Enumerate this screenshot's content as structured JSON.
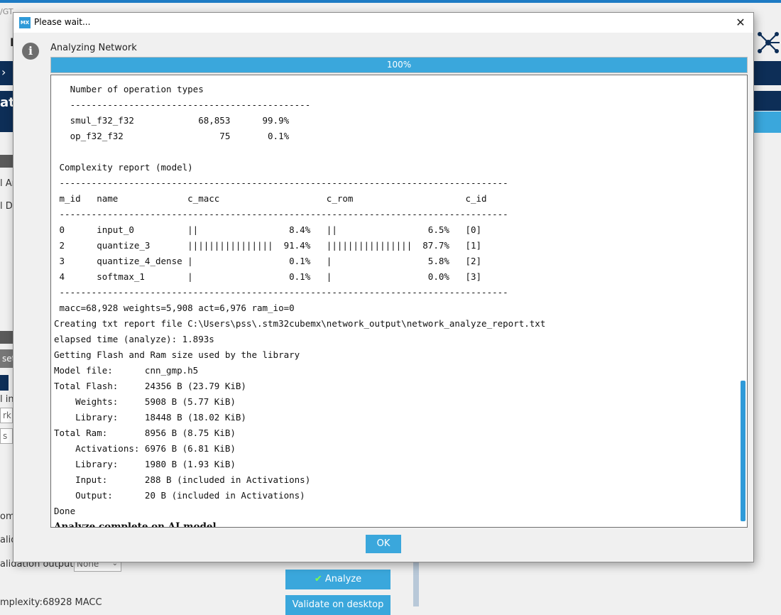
{
  "background": {
    "window_title_fragment": "/GT",
    "left_labels": [
      "ati",
      "l An",
      "l De",
      "set",
      "l in",
      "rk",
      "s",
      "omp",
      "alida"
    ],
    "validation_outputs_label": "alidation outputs:",
    "validation_outputs_value": "None",
    "complexity_label": "mplexity:",
    "complexity_value": "68928 MACC",
    "analyze_button": "Analyze",
    "validate_button": "Validate on desktop",
    "letter_d": "I"
  },
  "dialog": {
    "title": "Please wait...",
    "icon_label": "MX",
    "close_symbol": "✕",
    "status": "Analyzing Network",
    "progress_percent": 100,
    "progress_label": "100%",
    "ok_label": "OK",
    "log_lines": [
      "",
      "   Number of operation types",
      "   ---------------------------------------------",
      "   smul_f32_f32            68,853      99.9%",
      "   op_f32_f32                  75       0.1%",
      "",
      " Complexity report (model)",
      " ------------------------------------------------------------------------------------",
      " m_id   name             c_macc                    c_rom                     c_id",
      " ------------------------------------------------------------------------------------",
      " 0      input_0          ||                 8.4%   ||                 6.5%   [0]",
      " 2      quantize_3       ||||||||||||||||  91.4%   ||||||||||||||||  87.7%   [1]",
      " 3      quantize_4_dense |                  0.1%   |                  5.8%   [2]",
      " 4      softmax_1        |                  0.1%   |                  0.0%   [3]",
      " ------------------------------------------------------------------------------------",
      " macc=68,928 weights=5,908 act=6,976 ram_io=0",
      "Creating txt report file C:\\Users\\pss\\.stm32cubemx\\network_output\\network_analyze_report.txt",
      "elapsed time (analyze): 1.893s",
      "Getting Flash and Ram size used by the library",
      "Model file:      cnn_gmp.h5",
      "Total Flash:     24356 B (23.79 KiB)",
      "    Weights:     5908 B (5.77 KiB)",
      "    Library:     18448 B (18.02 KiB)",
      "Total Ram:       8956 B (8.75 KiB)",
      "    Activations: 6976 B (6.81 KiB)",
      "    Library:     1980 B (1.93 KiB)",
      "    Input:       288 B (included in Activations)",
      "    Output:      20 B (included in Activations)",
      "Done"
    ],
    "final_line": "Analyze complete on AI model"
  },
  "colors": {
    "accent": "#3aa7dc",
    "dark_blue": "#0d2e57"
  }
}
